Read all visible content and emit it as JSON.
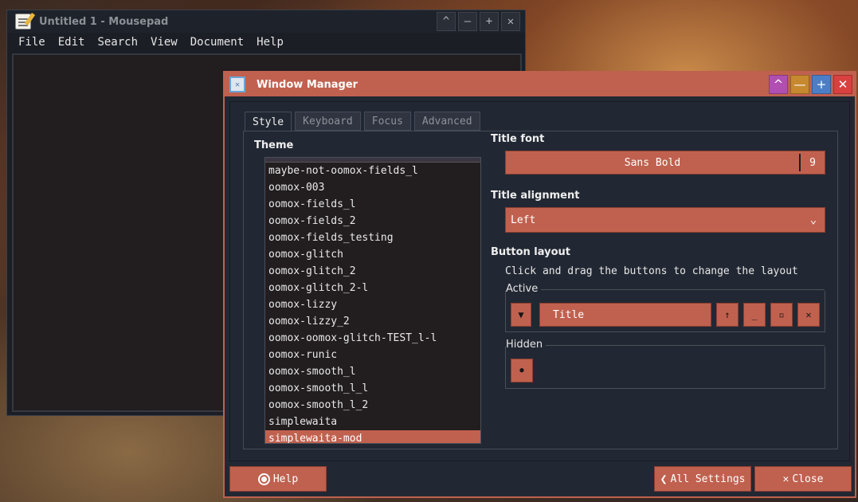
{
  "mousepad": {
    "title": "Untitled 1 - Mousepad",
    "controls": [
      "^",
      "—",
      "+",
      "✕"
    ],
    "menus": [
      "File",
      "Edit",
      "Search",
      "View",
      "Document",
      "Help"
    ]
  },
  "wm": {
    "title": "Window Manager",
    "controls": [
      "^",
      "—",
      "+",
      "✕"
    ],
    "control_colors": [
      "#b04fb0",
      "#c7892f",
      "#4a7fc8",
      "#d94040"
    ],
    "tabs": [
      "Style",
      "Keyboard",
      "Focus",
      "Advanced"
    ],
    "active_tab": "Style",
    "theme_label": "Theme",
    "themes": [
      "maybe-not-oomox-fields_l",
      "oomox-003",
      "oomox-fields_l",
      "oomox-fields_2",
      "oomox-fields_testing",
      "oomox-glitch",
      "oomox-glitch_2",
      "oomox-glitch_2-l",
      "oomox-lizzy",
      "oomox-lizzy_2",
      "oomox-oomox-glitch-TEST_l-l",
      "oomox-runic",
      "oomox-smooth_l",
      "oomox-smooth_l_l",
      "oomox-smooth_l_2",
      "simplewaita",
      "simplewaita-mod"
    ],
    "selected_theme": "simplewaita-mod",
    "title_font_label": "Title font",
    "title_font_name": "Sans Bold",
    "title_font_size": "9",
    "title_alignment_label": "Title alignment",
    "title_alignment_value": "Left",
    "button_layout_label": "Button layout",
    "button_layout_hint": "Click and drag the buttons to change the layout",
    "active_label": "Active",
    "active_title_button": "Title",
    "active_buttons": [
      "▼",
      "↑",
      "_",
      "▫",
      "✕"
    ],
    "hidden_label": "Hidden",
    "hidden_buttons": [
      "●"
    ],
    "help_label": "Help",
    "all_settings_label": "All Settings",
    "close_label": "Close",
    "accent": "#c0614f"
  }
}
